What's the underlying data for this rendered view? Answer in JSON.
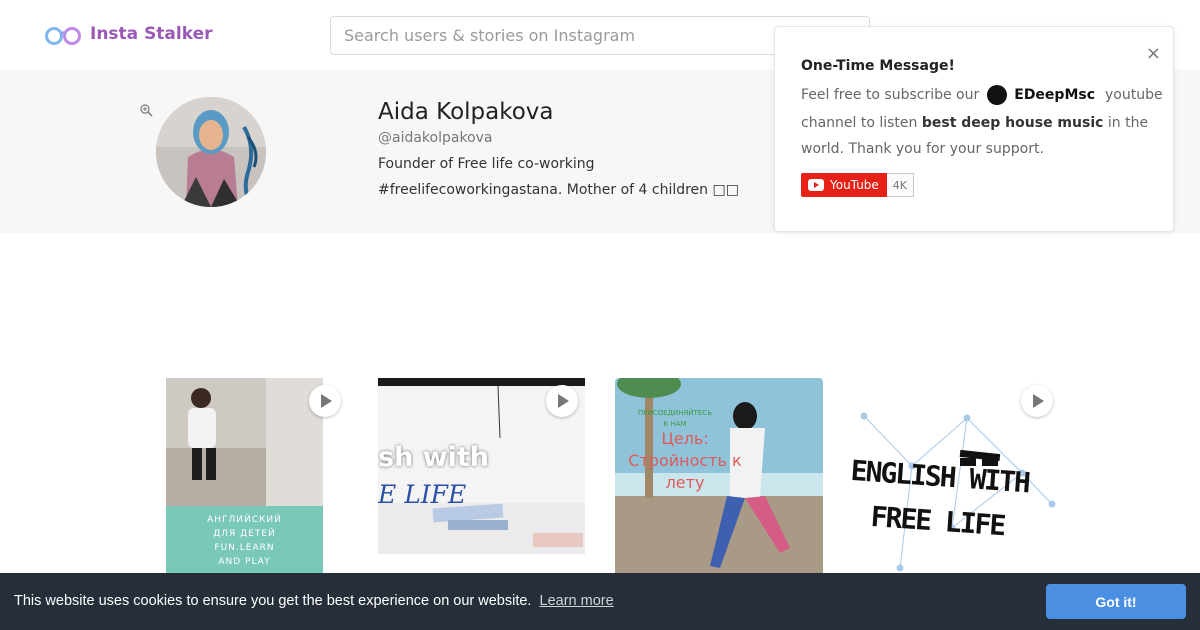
{
  "header": {
    "app_name": "Insta Stalker",
    "search_placeholder": "Search users & stories on Instagram"
  },
  "profile": {
    "name": "Aida Kolpakova",
    "handle": "@aidakolpakova",
    "bio_line1": "Founder of Free life co-working",
    "bio_line2": "#freelifecoworkingastana. Mother of 4 children □□"
  },
  "popup": {
    "close": "×",
    "title": "One-Time Message!",
    "line1_prefix": "Feel free to subscribe our",
    "brand_name": "EDeepMsc",
    "line1_suffix": "youtube",
    "line2_prefix": "channel to listen",
    "line2_bold": "best deep house music",
    "line2_suffix": "in the",
    "line3": "world. Thank you for your support.",
    "youtube_label": "YouTube",
    "youtube_count": "4K"
  },
  "stories": [
    {
      "type": "video",
      "caption_lines": [
        "АНГЛИЙСКИЙ",
        "ДЛЯ ДЕТЕЙ",
        "FUN.LEARN",
        "AND PLAY"
      ]
    },
    {
      "type": "video",
      "caption_lines": [
        "sh with",
        "E LIFE"
      ]
    },
    {
      "type": "image",
      "caption_lines": [
        "ПРИСОЕДИНЯЙТЕСЬ",
        "К НАМ",
        "Цель:",
        "Стройность к",
        "лету"
      ]
    },
    {
      "type": "video",
      "caption_lines": [
        "ENGLISH WITH",
        "FREE LIFE"
      ]
    }
  ],
  "cookie": {
    "message": "This website uses cookies to ensure you get the best experience on our website.",
    "learn_more": "Learn more",
    "button": "Got it!"
  },
  "colors": {
    "brand": "#9b59b6",
    "cookie_bg": "#252e39",
    "cookie_button": "#4b8fe2",
    "youtube_red": "#e62117"
  }
}
